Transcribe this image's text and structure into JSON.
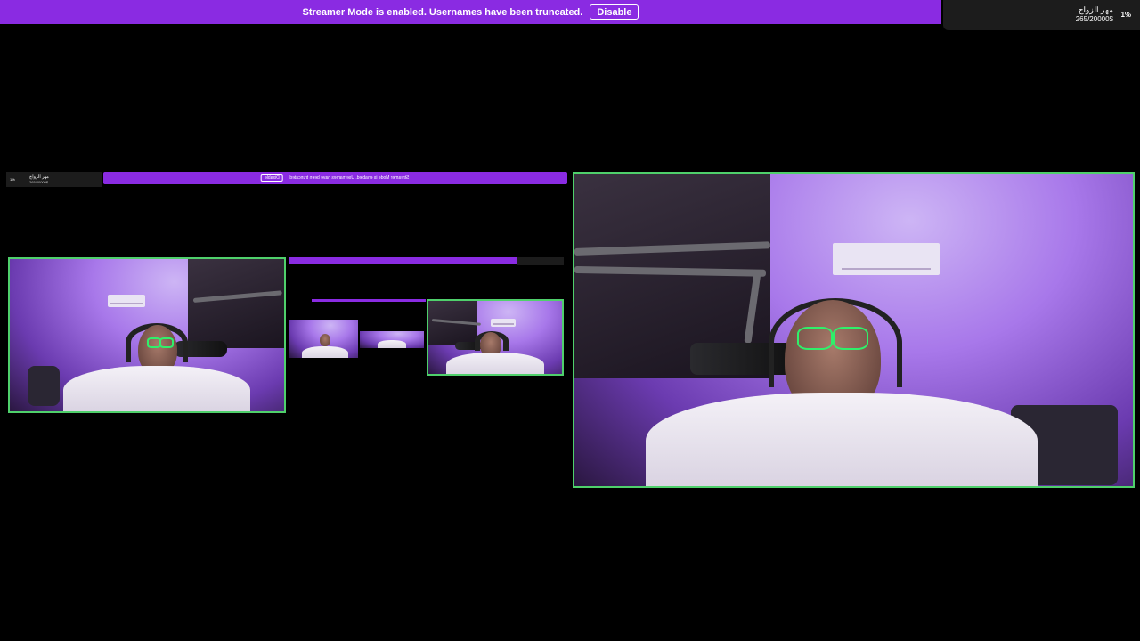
{
  "banner": {
    "message": "Streamer Mode is enabled. Usernames have been truncated.",
    "disable_label": "Disable"
  },
  "goal": {
    "title": "مهر الزواج",
    "progress": "265/20000$",
    "percent": "1%"
  },
  "colors": {
    "banner_purple": "#8a2be2",
    "active_speaker_border": "#4fd06b",
    "background": "#000000"
  }
}
